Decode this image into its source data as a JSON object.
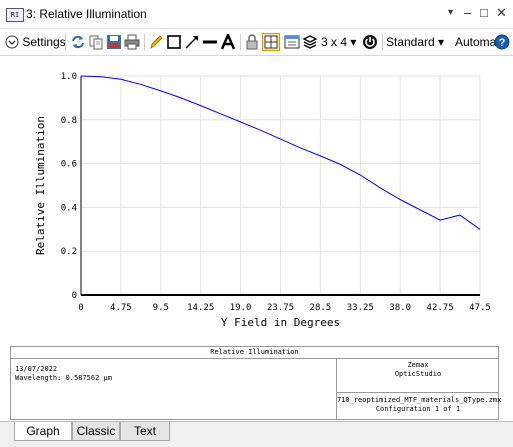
{
  "window": {
    "icon_text": "RI",
    "title": "3: Relative Illumination",
    "controls": [
      "▾",
      "–",
      "□",
      "✕"
    ]
  },
  "toolbar": {
    "settings_label": "Settings",
    "grid_label": "3 x 4 ▾",
    "standard_label": "Standard ▾",
    "automatic_label": "Automatic ▾"
  },
  "chart_data": {
    "type": "line",
    "title": "",
    "xlabel": "Y Field in Degrees",
    "ylabel": "Relative Illumination",
    "xlim": [
      0,
      47.5
    ],
    "ylim": [
      0,
      1.0
    ],
    "x_ticks": [
      "0",
      "4.75",
      "9.5",
      "14.25",
      "19.0",
      "23.75",
      "28.5",
      "33.25",
      "38.0",
      "42.75",
      "47.5"
    ],
    "y_ticks": [
      "0",
      "0.2",
      "0.4",
      "0.6",
      "0.8",
      "1.0"
    ],
    "grid": true,
    "series": [
      {
        "color": "#0000ff",
        "x": [
          0,
          2.4,
          4.75,
          7.1,
          9.5,
          11.9,
          14.25,
          16.6,
          19.0,
          21.4,
          23.75,
          26.1,
          28.5,
          30.9,
          33.25,
          35.6,
          38.0,
          40.4,
          42.75,
          45.1,
          47.5
        ],
        "y": [
          1.0,
          0.997,
          0.985,
          0.962,
          0.932,
          0.9,
          0.865,
          0.828,
          0.79,
          0.752,
          0.712,
          0.672,
          0.635,
          0.596,
          0.548,
          0.49,
          0.436,
          0.388,
          0.342,
          0.365,
          0.3
        ]
      }
    ],
    "baseline_color": "#000000"
  },
  "info": {
    "title": "Relative Illumination",
    "date": "13/07/2022",
    "wavelength": "Wavelength: 0.587562 µm",
    "brand_line1": "Zemax",
    "brand_line2": "OpticStudio",
    "file": "710_reoptimized_MTF_materials_QType.zmx",
    "configuration": "Configuration 1 of 1"
  },
  "tabs": [
    "Graph",
    "Classic",
    "Text"
  ],
  "colors": {
    "accent": "#1a5fb4",
    "series": "#0000ff"
  }
}
